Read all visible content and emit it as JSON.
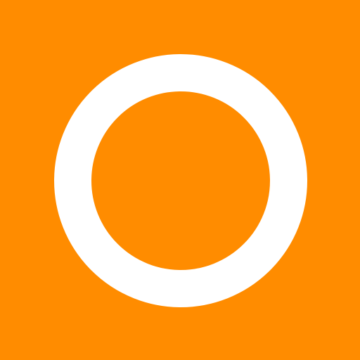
{
  "icon": {
    "name": "ring-icon",
    "background_color": "#FF8C00",
    "ring_color": "#FFFFFF",
    "description_shape": "circle-outline"
  }
}
